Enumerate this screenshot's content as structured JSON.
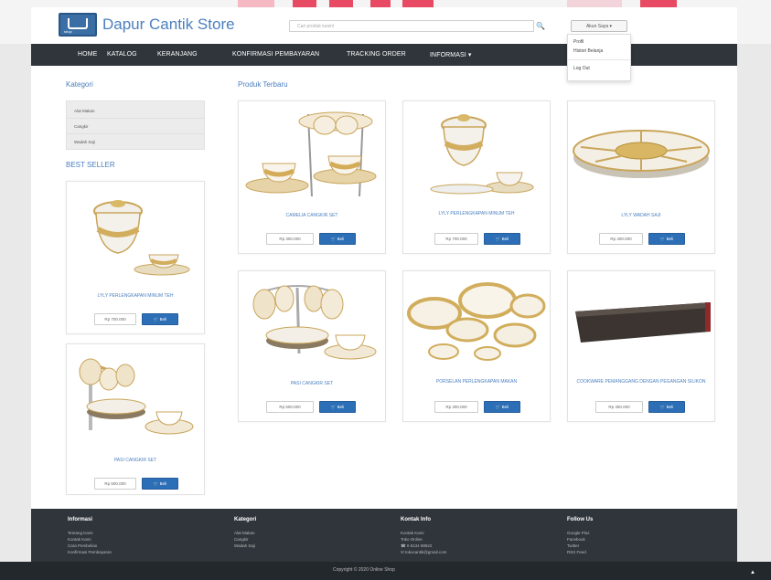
{
  "header": {
    "store_name": "Dapur Cantik Store",
    "search_placeholder": "Cari produk kesini",
    "account_label": "Akun Saya ▾",
    "logo_sub": "shop"
  },
  "account_menu": [
    "Profil",
    "Histori Belanja",
    "Log Out"
  ],
  "nav": [
    "HOME",
    "KATALOG",
    "KERANJANG",
    "KONFIRMASI PEMBAYARAN",
    "TRACKING ORDER",
    "INFORMASI ▾"
  ],
  "sidebar": {
    "kategori_title": "Kategori",
    "categories": [
      "Alat Makan",
      "Cangkir",
      "Wadah Saji"
    ],
    "best_seller_title": "BEST SELLER",
    "best_sellers": [
      {
        "name": "LYLY PERLENGKAPAN MINUM TEH",
        "price": "Rp 700.000",
        "buy": "Beli"
      },
      {
        "name": "PASI CANGKIR SET",
        "price": "Rp 500.000",
        "buy": "Beli"
      }
    ]
  },
  "main": {
    "title": "Produk Terbaru",
    "products": [
      {
        "name": "CAMELIA CANGKIR SET",
        "price": "Rp 300.000",
        "buy": "Beli"
      },
      {
        "name": "LYLY PERLENGKAPAN MINUM TEH",
        "price": "Rp 700.000",
        "buy": "Beli"
      },
      {
        "name": "LYLY WADAH SAJI",
        "price": "Rp 400.000",
        "buy": "Beli"
      },
      {
        "name": "PASI CANGKIR SET",
        "price": "Rp 500.000",
        "buy": "Beli"
      },
      {
        "name": "PORSELAN PERLENGKAPAN MAKAN",
        "price": "Rp 300.000",
        "buy": "Beli"
      },
      {
        "name": "COOKWARE PEMANGGANG DENGAN PEGANGAN SILIKON",
        "price": "Rp 450.000",
        "buy": "Beli"
      }
    ]
  },
  "footer": {
    "cols": [
      {
        "title": "Informasi",
        "links": [
          "Tentang Kami",
          "Kontak Kami",
          "Cara Pembelian",
          "Konfirmasi Pembayaran"
        ]
      },
      {
        "title": "Kategori",
        "links": [
          "Alat Makan",
          "Cangkir",
          "Wadah Saji"
        ]
      },
      {
        "title": "Kontak Info",
        "links": [
          "Kontak Kami",
          "Toko Online",
          "0 8134 88822",
          "tokocantik@gmail.com"
        ]
      },
      {
        "title": "Follow Us",
        "links": [
          "Google Plus",
          "Facebook",
          "Twitter",
          "RSS Feed"
        ]
      }
    ],
    "copyright": "Copyright © 2020 Online Shop"
  },
  "colors": {
    "accent": "#4a7fbf",
    "nav_bg": "#2f353b",
    "buy_btn": "#2d6fb7"
  }
}
